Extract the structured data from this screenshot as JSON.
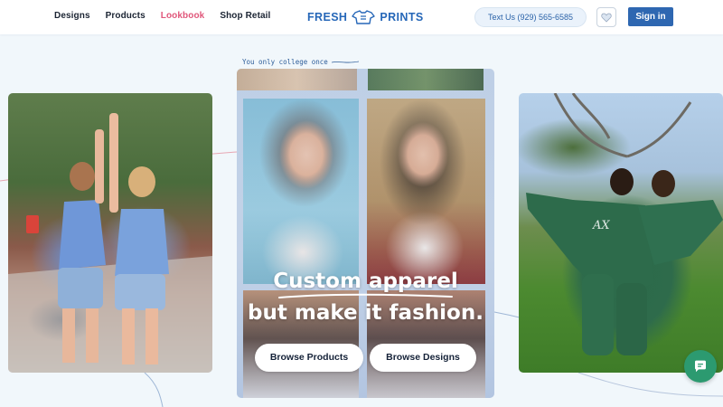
{
  "nav": {
    "items": [
      {
        "label": "Designs"
      },
      {
        "label": "Products"
      },
      {
        "label": "Lookbook"
      },
      {
        "label": "Shop Retail"
      }
    ],
    "active": "Lookbook"
  },
  "logo": {
    "left": "FRESH",
    "right": "PRINTS",
    "icon": "shirt-logo-icon"
  },
  "header": {
    "text_us": "Text Us (929) 565-6585",
    "wishlist_icon": "heart-icon",
    "signin": "Sign in"
  },
  "hero": {
    "tagline": "You only college once",
    "headline_line1": "Custom apparel",
    "headline_line2": "but make it fashion.",
    "buttons": {
      "browse_products": "Browse Products",
      "browse_designs": "Browse Designs"
    }
  },
  "chat": {
    "icon": "chat-bubble-icon"
  },
  "colors": {
    "accent": "#2e67b1",
    "active_nav": "#e0567a",
    "chat": "#2c9a70",
    "background": "#f1f7fb"
  }
}
